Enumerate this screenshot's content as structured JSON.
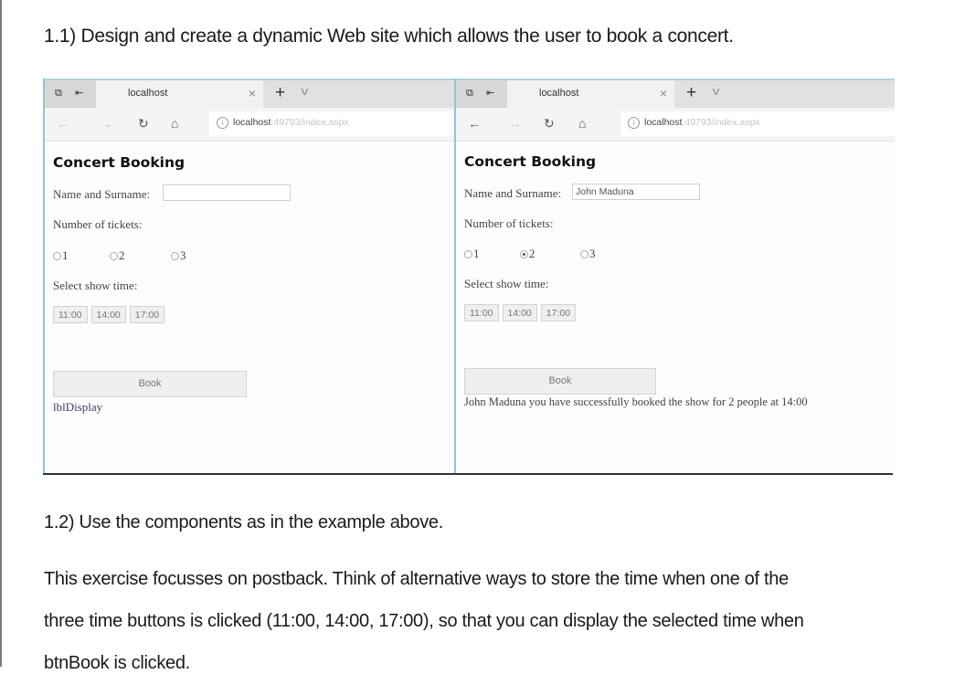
{
  "document": {
    "heading": "1.1) Design and create a dynamic Web site which allows the user to book a concert.",
    "subheading": "1.2) Use the components as in the example above.",
    "paragraph_lines": [
      "This exercise focusses on postback. Think of alternative ways to store the time when one of the",
      "three time buttons is clicked (11:00, 14:00, 17:00), so that you can display the selected time when",
      "btnBook is clicked."
    ]
  },
  "browsers": [
    {
      "tab_title": "localhost",
      "address_host": "localhost",
      "address_path": ":49793/index.aspx",
      "app": {
        "title": "Concert Booking",
        "name_label": "Name and Surname:",
        "name_value": "",
        "tickets_label": "Number of tickets:",
        "ticket_options": [
          "1",
          "2",
          "3"
        ],
        "selected_ticket": null,
        "time_label": "Select show time:",
        "times": [
          "11:00",
          "14:00",
          "17:00"
        ],
        "book_label": "Book",
        "display_text": "lblDisplay"
      }
    },
    {
      "tab_title": "localhost",
      "address_host": "localhost",
      "address_path": ":49793/index.aspx",
      "app": {
        "title": "Concert Booking",
        "name_label": "Name and Surname:",
        "name_value": "John Maduna",
        "tickets_label": "Number of tickets:",
        "ticket_options": [
          "1",
          "2",
          "3"
        ],
        "selected_ticket": "2",
        "time_label": "Select show time:",
        "times": [
          "11:00",
          "14:00",
          "17:00"
        ],
        "book_label": "Book",
        "display_text": "John Maduna you have successfully booked the show for 2 people at 14:00"
      }
    }
  ],
  "icons": {
    "close": "×",
    "plus": "+",
    "chevron_down": "∨",
    "back": "←",
    "forward": "→",
    "refresh": "↻",
    "home": "⌂",
    "info": "i"
  }
}
